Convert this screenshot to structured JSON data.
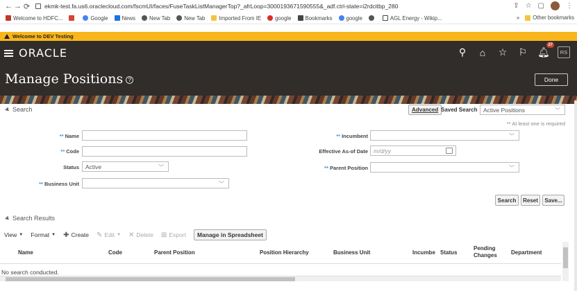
{
  "browser": {
    "url": "ekmk-test.fa.us6.oraclecloud.com/fscmUI/faces/FuseTaskListManagerTop?_afrLoop=3000193671590555&_adf.ctrl-state=i2rdcitbp_280",
    "bookmarks": [
      {
        "label": "Welcome to HDFC...",
        "color": "#c0392b"
      },
      {
        "label": "",
        "color": "#d44638"
      },
      {
        "label": "Google",
        "color": "#4285f4"
      },
      {
        "label": "News",
        "color": "#1a73e8"
      },
      {
        "label": "New Tab",
        "color": "#555555"
      },
      {
        "label": "New Tab",
        "color": "#555555"
      },
      {
        "label": "Imported From IE",
        "color": "#f4c542"
      },
      {
        "label": "google",
        "color": "#d93025"
      },
      {
        "label": "Bookmarks",
        "color": "#444444"
      },
      {
        "label": "google",
        "color": "#4285f4"
      },
      {
        "label": "",
        "color": "#555555"
      },
      {
        "label": "AGL Energy - Wikip...",
        "color": "#444444"
      }
    ],
    "more": "»",
    "other_bookmarks": "Other bookmarks"
  },
  "dev_banner": "Welcome to DEV Testing",
  "header": {
    "logo": "ORACLE",
    "notification_count": "27",
    "user_initials": "RS"
  },
  "page": {
    "title": "Manage Positions",
    "help": "?",
    "done": "Done"
  },
  "search": {
    "section_label": "Search",
    "advanced": "Advanced",
    "saved_search_label": "Saved Search",
    "saved_search_value": "Active Positions",
    "required_note": "At least one is required",
    "fields": {
      "name_label": "Name",
      "code_label": "Code",
      "status_label": "Status",
      "status_value": "Active",
      "business_unit_label": "Business Unit",
      "incumbent_label": "Incumbent",
      "effective_label": "Effective As-of Date",
      "effective_placeholder": "m/d/yy",
      "parent_label": "Parent Position"
    },
    "buttons": {
      "search": "Search",
      "reset": "Reset",
      "save": "Save..."
    }
  },
  "results": {
    "section_label": "Search Results",
    "toolbar": {
      "view": "View",
      "format": "Format",
      "create": "Create",
      "edit": "Edit",
      "delete": "Delete",
      "export": "Export",
      "spreadsheet": "Manage in Spreadsheet"
    },
    "columns": [
      "Name",
      "Code",
      "Parent Position",
      "Position Hierarchy",
      "Business Unit",
      "Incumbe",
      "Status",
      "Pending Changes",
      "Department"
    ],
    "empty_text": "No search conducted."
  }
}
